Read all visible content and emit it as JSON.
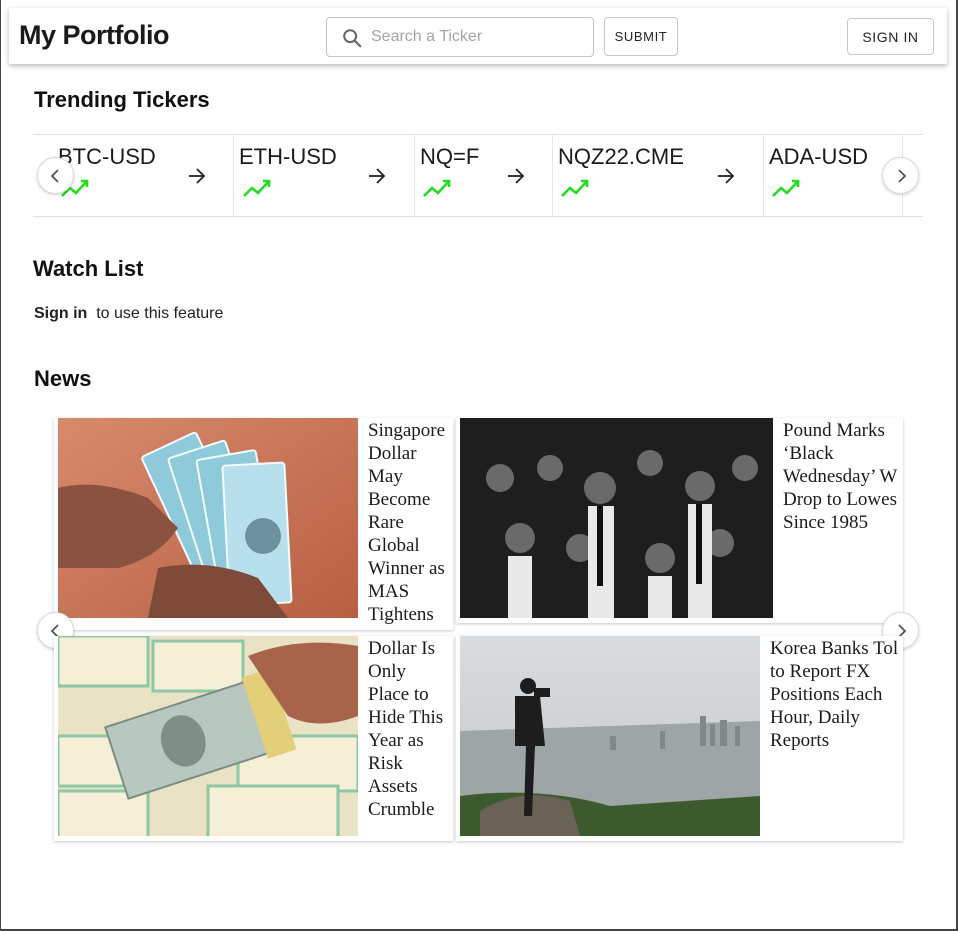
{
  "header": {
    "logo": "My Portfolio",
    "search_placeholder": "Search a Ticker",
    "submit_label": "SUBMIT",
    "signin_label": "SIGN IN"
  },
  "trending": {
    "title": "Trending Tickers",
    "tickers": [
      {
        "symbol": "BTC-USD",
        "trend": "up"
      },
      {
        "symbol": "ETH-USD",
        "trend": "up"
      },
      {
        "symbol": "NQ=F",
        "trend": "up"
      },
      {
        "symbol": "NQZ22.CME",
        "trend": "up"
      },
      {
        "symbol": "ADA-USD",
        "trend": "up"
      }
    ],
    "trend_color": "#22dd22"
  },
  "watchlist": {
    "title": "Watch List",
    "signin_link": "Sign in",
    "message": "to use this feature"
  },
  "news": {
    "title": "News",
    "articles": [
      {
        "headline": "Singapore\nDollar\nMay\nBecome\nRare\nGlobal\nWinner as\nMAS\nTightens",
        "image": "singapore-dollar-notes-photo"
      },
      {
        "headline": "Pound Marks\n‘Black\nWednesday’ W\nDrop to Lowes\nSince 1985",
        "image": "trading-floor-photo"
      },
      {
        "headline": "Dollar Is\nOnly\nPlace to\nHide This\nYear as\nRisk\nAssets\nCrumble",
        "image": "dollar-bills-photo"
      },
      {
        "headline": "Korea Banks Tol\nto Report FX\nPositions Each\nHour, Daily\nReports",
        "image": "seoul-photographer-photo"
      }
    ]
  }
}
